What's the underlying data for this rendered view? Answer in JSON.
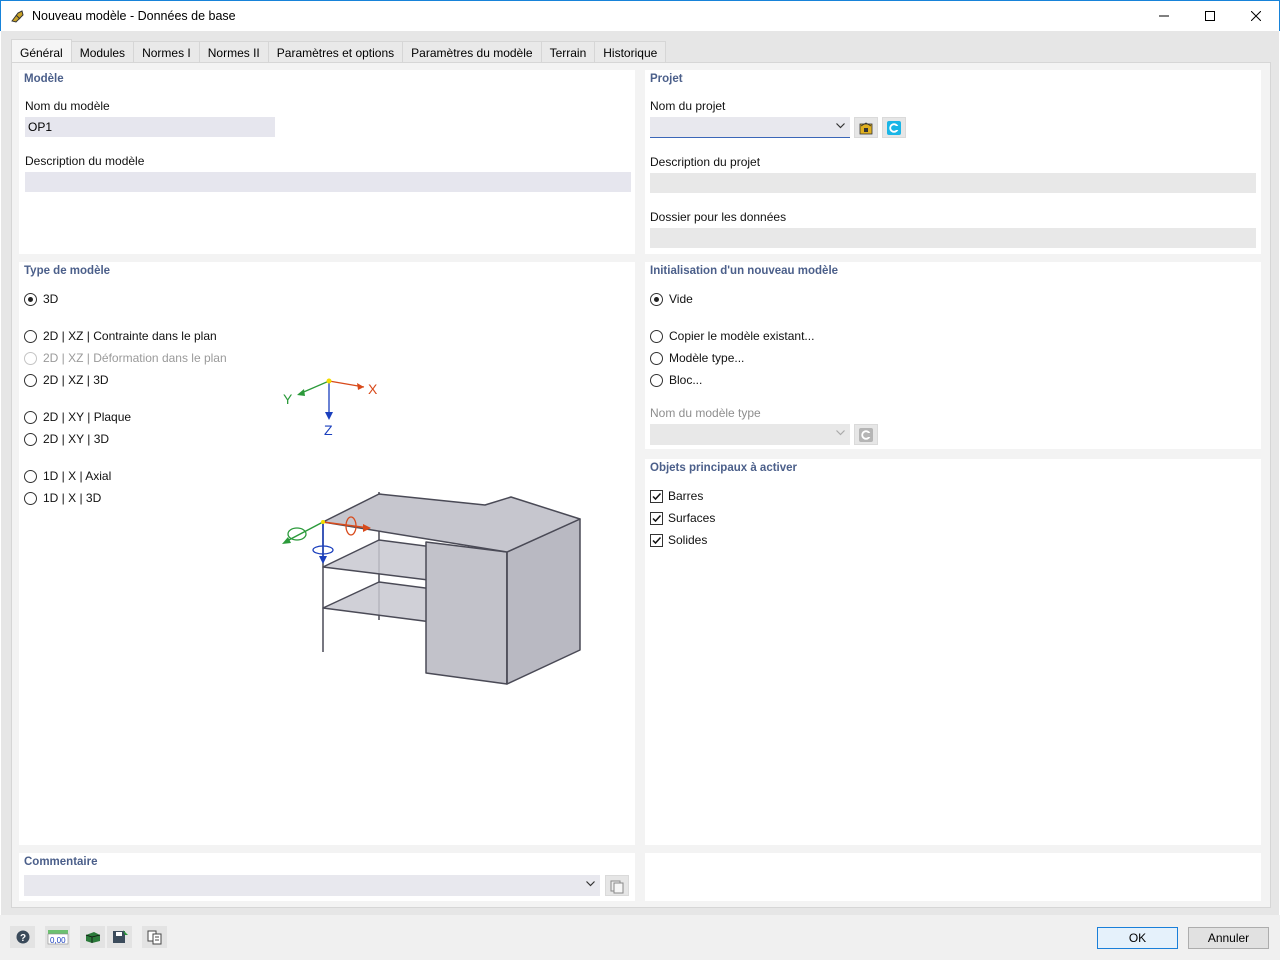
{
  "window": {
    "title": "Nouveau modèle - Données de base",
    "title_border_color": "#1783d9"
  },
  "tabs": [
    {
      "label": "Général",
      "active": true
    },
    {
      "label": "Modules"
    },
    {
      "label": "Normes I"
    },
    {
      "label": "Normes II"
    },
    {
      "label": "Paramètres et options"
    },
    {
      "label": "Paramètres du modèle"
    },
    {
      "label": "Terrain"
    },
    {
      "label": "Historique"
    }
  ],
  "model": {
    "section_title": "Modèle",
    "name_label": "Nom du modèle",
    "name_value": "OP1",
    "description_label": "Description du modèle",
    "description_value": ""
  },
  "project": {
    "section_title": "Projet",
    "name_label": "Nom du projet",
    "name_value": "",
    "description_label": "Description du projet",
    "description_value": "",
    "folder_label": "Dossier pour les données",
    "folder_value": ""
  },
  "model_type": {
    "section_title": "Type de modèle",
    "options": [
      {
        "label": "3D",
        "checked": true
      },
      {
        "label": "2D | XZ | Contrainte dans le plan"
      },
      {
        "label": "2D | XZ | Déformation dans le plan",
        "disabled": true
      },
      {
        "label": "2D | XZ | 3D"
      },
      {
        "label": "2D | XY | Plaque"
      },
      {
        "label": "2D | XY | 3D"
      },
      {
        "label": "1D | X | Axial"
      },
      {
        "label": "1D | X | 3D"
      }
    ],
    "axes": {
      "x": "X",
      "y": "Y",
      "z": "Z"
    }
  },
  "init": {
    "section_title": "Initialisation d'un nouveau modèle",
    "options": [
      {
        "label": "Vide",
        "checked": true
      },
      {
        "label": "Copier le modèle existant..."
      },
      {
        "label": "Modèle type..."
      },
      {
        "label": "Bloc..."
      }
    ],
    "template_label": "Nom du modèle type",
    "template_value": ""
  },
  "objects": {
    "section_title": "Objets principaux à activer",
    "items": [
      {
        "label": "Barres",
        "checked": true
      },
      {
        "label": "Surfaces",
        "checked": true
      },
      {
        "label": "Solides",
        "checked": true
      }
    ]
  },
  "comment": {
    "section_title": "Commentaire",
    "value": ""
  },
  "footer": {
    "ok_label": "OK",
    "cancel_label": "Annuler",
    "units_icon_text": "0,00"
  }
}
